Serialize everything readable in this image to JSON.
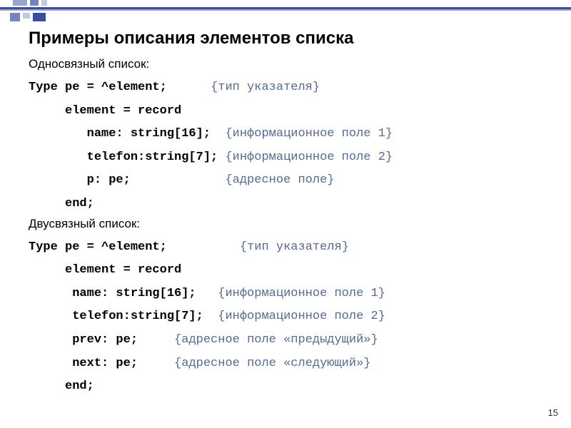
{
  "title": "Примеры описания элементов списка",
  "section1": {
    "label": "Односвязный список:",
    "lines": [
      {
        "code": "Type pe = ^element;",
        "comment": "{тип указателя}",
        "gap": "      "
      },
      {
        "code": "     element = record",
        "comment": "",
        "gap": ""
      },
      {
        "code": "        name: string[16];",
        "comment": "{информационное поле 1}",
        "gap": "  "
      },
      {
        "code": "        telefon:string[7];",
        "comment": "{информационное поле 2}",
        "gap": " "
      },
      {
        "code": "        p: pe;",
        "comment": "{адресное поле}",
        "gap": "             "
      },
      {
        "code": "     end;",
        "comment": "",
        "gap": ""
      }
    ]
  },
  "section2": {
    "label": "Двусвязный список:",
    "lines": [
      {
        "code": "Type pe = ^element;",
        "comment": "{тип указателя}",
        "gap": "          "
      },
      {
        "code": "     element = record",
        "comment": "",
        "gap": ""
      },
      {
        "code": "      name: string[16];",
        "comment": "{информационное поле 1}",
        "gap": "   "
      },
      {
        "code": "      telefon:string[7];",
        "comment": "{информационное поле 2}",
        "gap": "  "
      },
      {
        "code": "      prev: pe;",
        "comment": "{адресное поле «предыдущий»}",
        "gap": "     "
      },
      {
        "code": "      next: pe;",
        "comment": "{адресное поле «следующий»}",
        "gap": "     "
      },
      {
        "code": "     end;",
        "comment": "",
        "gap": ""
      }
    ]
  },
  "pageNumber": "15"
}
